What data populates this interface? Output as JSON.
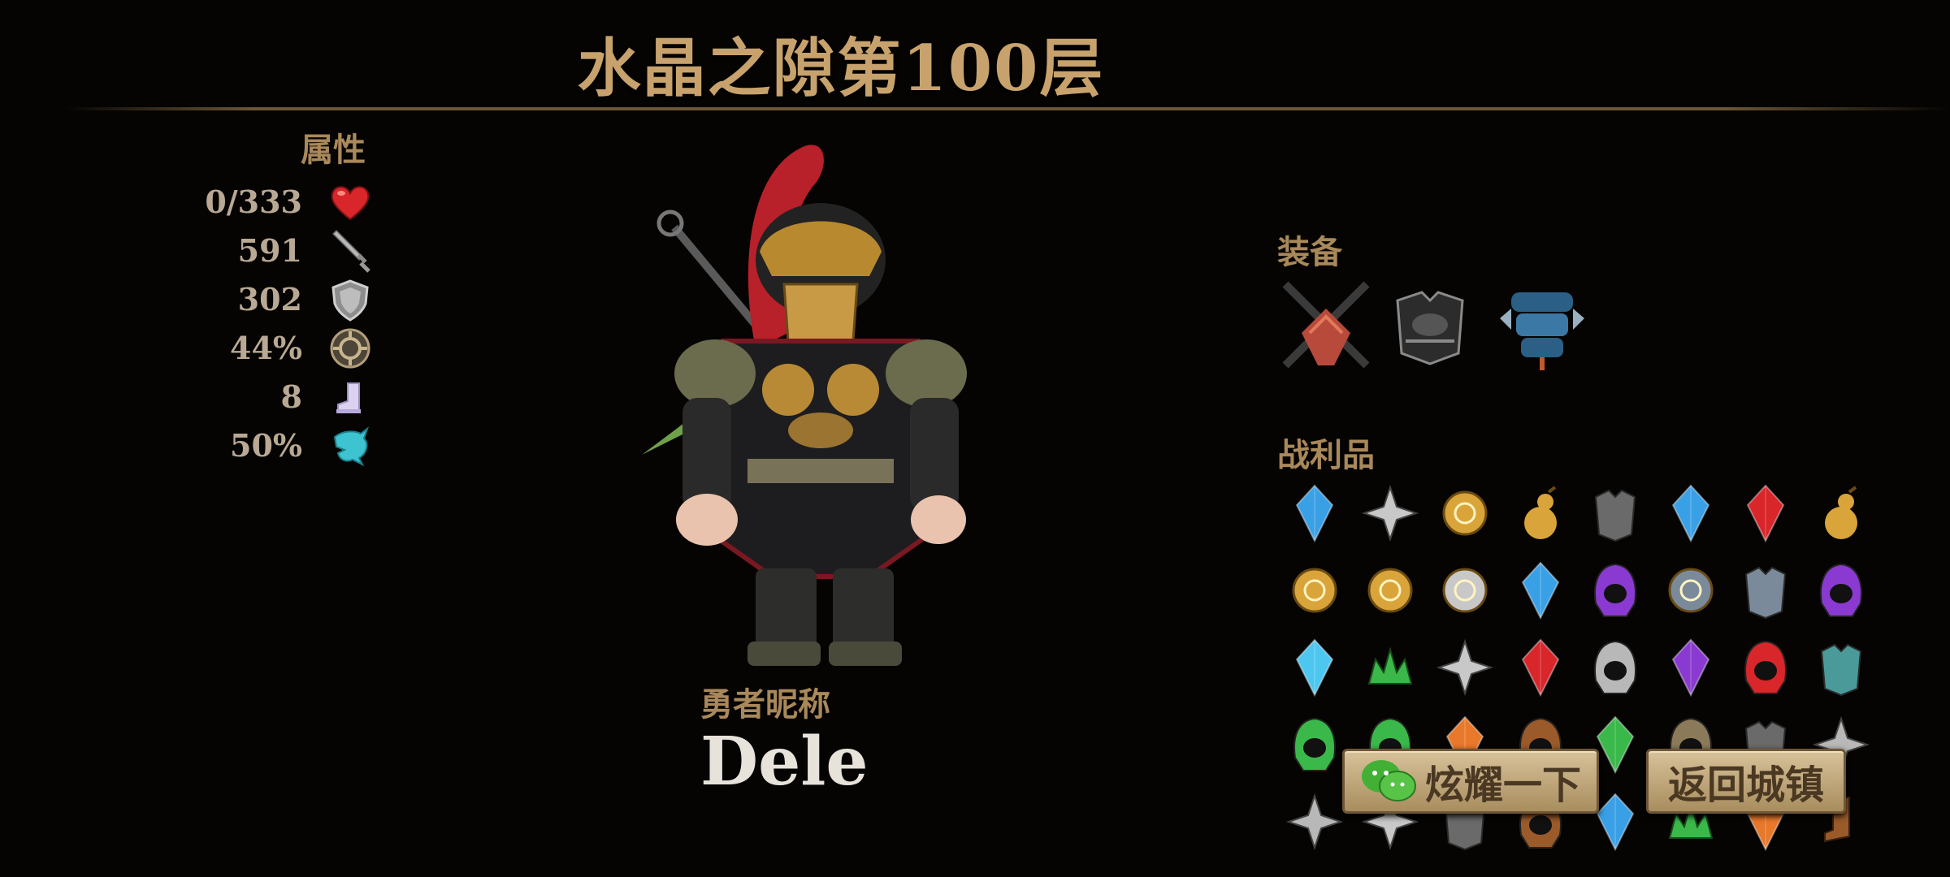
{
  "header": {
    "title": "水晶之隙第100层"
  },
  "attributes": {
    "label": "属性",
    "stats": [
      {
        "value": "0/333",
        "icon": "heart-icon"
      },
      {
        "value": "591",
        "icon": "sword-icon"
      },
      {
        "value": "302",
        "icon": "shield-icon"
      },
      {
        "value": "44%",
        "icon": "crit-rune-icon"
      },
      {
        "value": "8",
        "icon": "boot-icon"
      },
      {
        "value": "50%",
        "icon": "dodge-spirit-icon"
      }
    ]
  },
  "hero": {
    "nickname_label": "勇者昵称",
    "nickname": "Dele",
    "portrait": "armored-warrior-character"
  },
  "equipment": {
    "label": "装备",
    "items": [
      "crossed-swords-icon",
      "dark-chest-armor-icon",
      "blue-spiked-armor-icon"
    ]
  },
  "loot": {
    "label": "战利品",
    "items": [
      "blue-crystal-icon",
      "curved-dagger-icon",
      "gold-fire-coin-icon",
      "gold-gourd-icon",
      "iron-armor-icon",
      "blue-gem-icon",
      "red-crystal-icon",
      "gold-gourd-icon",
      "gold-ring-icon",
      "gold-coin-icon",
      "chain-ring-icon",
      "blue-gem-icon",
      "purple-hood-icon",
      "spiked-ring-icon",
      "gauntlet-icon",
      "purple-hood-icon",
      "cyan-crystal-icon",
      "green-crown-icon",
      "shuriken-icon",
      "red-gem-icon",
      "silver-helmet-icon",
      "purple-gem-icon",
      "red-hood-icon",
      "teal-armor-icon",
      "green-helm-icon",
      "green-helm-icon",
      "orange-gem-icon",
      "brown-hood-icon",
      "green-crystal-icon",
      "bat-helm-icon",
      "iron-armor-icon",
      "silver-claw-icon",
      "silver-claw-icon",
      "curved-dagger-icon",
      "iron-armor-icon",
      "brown-hood-icon",
      "blue-crystal-icon",
      "green-flame-icon",
      "orange-gem-icon",
      "brown-boot-icon"
    ]
  },
  "buttons": {
    "share_label": "炫耀一下",
    "return_label": "返回城镇"
  },
  "colors": {
    "title": "#c8a26c",
    "label": "#a9885a",
    "stat_text": "#b9a994",
    "button_bg": "#c9b183"
  }
}
